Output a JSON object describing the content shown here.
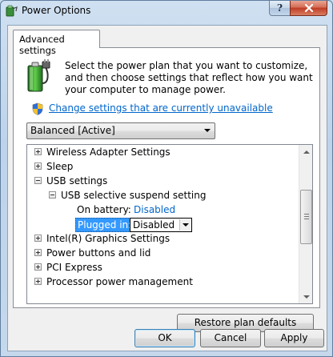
{
  "window": {
    "title": "Power Options"
  },
  "tabs": [
    {
      "label": "Advanced settings"
    }
  ],
  "intro_text": "Select the power plan that you want to customize, and then choose settings that reflect how you want your computer to manage power.",
  "change_settings_link": "Change settings that are currently unavailable",
  "plan_select": {
    "selected": "Balanced [Active]"
  },
  "tree": {
    "items": [
      {
        "label": "Wireless Adapter Settings",
        "expanded": false
      },
      {
        "label": "Sleep",
        "expanded": false
      },
      {
        "label": "USB settings",
        "expanded": true
      },
      {
        "label": "USB selective suspend setting",
        "expanded": true
      },
      {
        "label": "On battery:",
        "value": "Disabled"
      },
      {
        "label": "Plugged in:",
        "value": "Disabled"
      },
      {
        "label": "Intel(R) Graphics Settings",
        "expanded": false
      },
      {
        "label": "Power buttons and lid",
        "expanded": false
      },
      {
        "label": "PCI Express",
        "expanded": false
      },
      {
        "label": "Processor power management",
        "expanded": false
      }
    ]
  },
  "buttons": {
    "restore": "Restore plan defaults",
    "ok": "OK",
    "cancel": "Cancel",
    "apply": "Apply",
    "help": "?"
  },
  "icons": {
    "app": "power-options-icon",
    "battery": "battery-plug-icon",
    "shield": "uac-shield-icon",
    "close": "close-icon"
  },
  "colors": {
    "link": "#0066cc",
    "selection": "#3399ff",
    "close_button": "#c84a31"
  }
}
